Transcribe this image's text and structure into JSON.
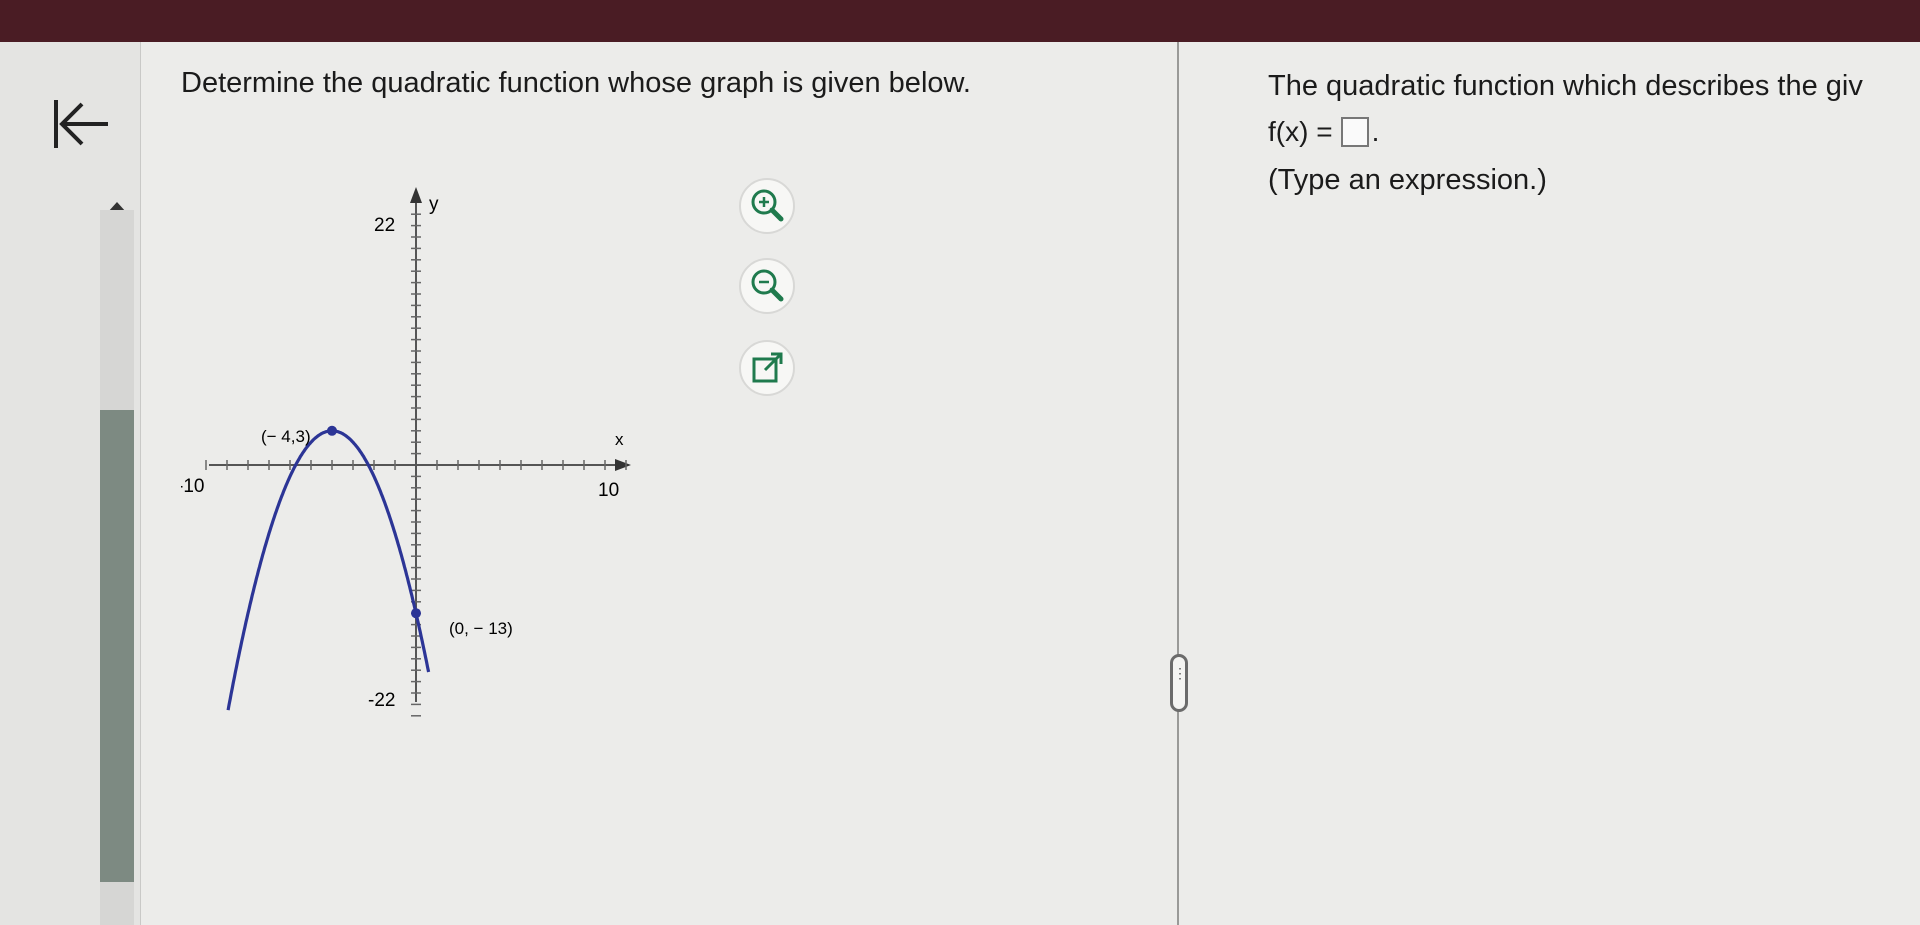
{
  "question": {
    "prompt": "Determine the quadratic function whose graph is given below."
  },
  "graph": {
    "y_axis_label": "y",
    "x_axis_label": "x",
    "y_max_label": "22",
    "y_min_label": "-22",
    "x_min_label": "-10",
    "x_max_label": "10",
    "vertex_label": "(− 4,3)",
    "intercept_label": "(0, − 13)",
    "curve_color": "#2c3596"
  },
  "tools": [
    "zoom-in-icon",
    "zoom-out-icon",
    "popout-icon"
  ],
  "answer": {
    "prompt": "The quadratic function which describes the giv",
    "lhs": "f(x) =",
    "period": ".",
    "hint": "(Type an expression.)"
  }
}
